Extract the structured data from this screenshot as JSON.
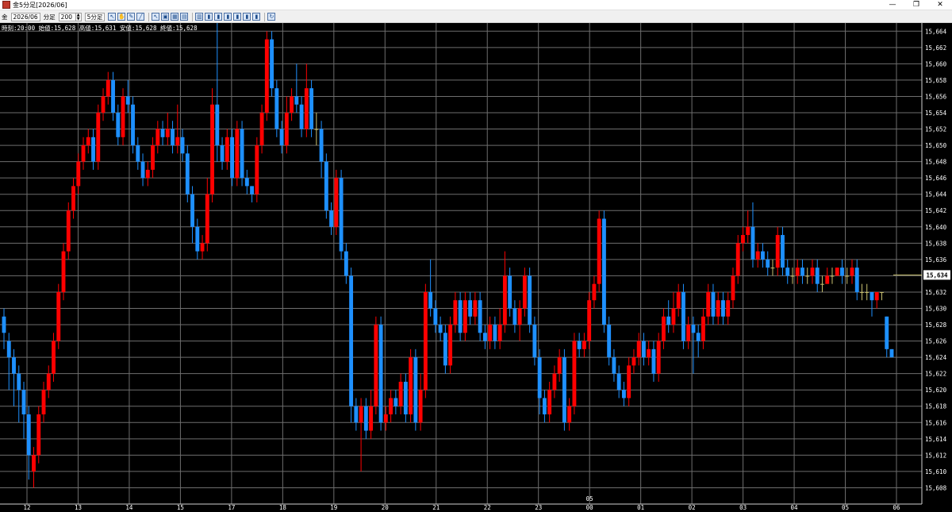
{
  "window": {
    "title": "金5分足[2026/06]",
    "controls": [
      "—",
      "❐",
      "✕"
    ]
  },
  "toolbar": {
    "symbol": "金",
    "contract": "2026/06",
    "interval_unit": "分足",
    "bar_count": "200",
    "interval": "5分足"
  },
  "info_bar": "時刻:20:00 始値:15,628 高値:15,631 安値:15,628 終値:15,628",
  "colors": {
    "up": "#ff0000",
    "down": "#1e90ff",
    "doji": "#c8c070",
    "grid": "#6e6e6e",
    "text": "#ffffff"
  },
  "chart_data": {
    "type": "candlestick",
    "y_range": [
      15606,
      15665
    ],
    "y_ticks": [
      15608,
      15610,
      15612,
      15614,
      15616,
      15618,
      15620,
      15622,
      15624,
      15626,
      15628,
      15630,
      15632,
      15634,
      15636,
      15638,
      15640,
      15642,
      15644,
      15646,
      15648,
      15650,
      15652,
      15654,
      15656,
      15658,
      15660,
      15662,
      15664
    ],
    "y_tick_labels": [
      "15,608",
      "15,610",
      "15,612",
      "15,614",
      "15,616",
      "15,618",
      "15,620",
      "15,622",
      "15,624",
      "15,626",
      "15,628",
      "15,630",
      "15,632",
      "15,634",
      "15,636",
      "15,638",
      "15,640",
      "15,642",
      "15,644",
      "15,646",
      "15,648",
      "15,650",
      "15,652",
      "15,654",
      "15,656",
      "15,658",
      "15,660",
      "15,662",
      "15,664"
    ],
    "current_price": "15,634",
    "current_value": 15634.1,
    "x_labels": [
      "12",
      "13",
      "14",
      "15",
      "17",
      "18",
      "19",
      "20",
      "21",
      "22",
      "23",
      "00",
      "01",
      "02",
      "03",
      "04",
      "05",
      "06"
    ],
    "month_label": "05",
    "candles": [
      [
        15629,
        15627,
        15630,
        15625
      ],
      [
        15626,
        15624,
        15627,
        15620
      ],
      [
        15624,
        15622,
        15625,
        15618
      ],
      [
        15622,
        15620,
        15623,
        15616
      ],
      [
        15620,
        15617,
        15621,
        15614
      ],
      [
        15617,
        15612,
        15618,
        15609
      ],
      [
        15610,
        15612,
        15613,
        15608
      ],
      [
        15612,
        15617,
        15618,
        15611
      ],
      [
        15617,
        15620,
        15621,
        15616
      ],
      [
        15620,
        15622,
        15623,
        15619
      ],
      [
        15622,
        15626,
        15627,
        15621
      ],
      [
        15626,
        15632,
        15633,
        15625
      ],
      [
        15632,
        15637,
        15638,
        15631
      ],
      [
        15637,
        15642,
        15643,
        15636
      ],
      [
        15642,
        15645,
        15646,
        15641
      ],
      [
        15645,
        15648,
        15649,
        15644
      ],
      [
        15648,
        15650,
        15651,
        15647
      ],
      [
        15650,
        15651,
        15652,
        15649
      ],
      [
        15651,
        15648,
        15652,
        15647
      ],
      [
        15648,
        15654,
        15655,
        15647
      ],
      [
        15654,
        15656,
        15657,
        15653
      ],
      [
        15656,
        15658,
        15659,
        15655
      ],
      [
        15658,
        15654,
        15659,
        15653
      ],
      [
        15654,
        15651,
        15655,
        15650
      ],
      [
        15651,
        15656,
        15657,
        15650
      ],
      [
        15656,
        15655,
        15658,
        15654
      ],
      [
        15655,
        15650,
        15656,
        15649
      ],
      [
        15650,
        15648,
        15651,
        15647
      ],
      [
        15648,
        15646,
        15649,
        15645
      ],
      [
        15646,
        15647,
        15648,
        15645
      ],
      [
        15647,
        15650,
        15651,
        15646
      ],
      [
        15650,
        15652,
        15653,
        15649
      ],
      [
        15652,
        15651,
        15653,
        15650
      ],
      [
        15651,
        15652,
        15654,
        15650
      ],
      [
        15652,
        15650,
        15653,
        15649
      ],
      [
        15650,
        15651,
        15655,
        15649
      ],
      [
        15651,
        15649,
        15652,
        15648
      ],
      [
        15649,
        15644,
        15650,
        15643
      ],
      [
        15644,
        15640,
        15645,
        15638
      ],
      [
        15640,
        15637,
        15641,
        15636
      ],
      [
        15637,
        15638,
        15639,
        15636
      ],
      [
        15638,
        15644,
        15646,
        15637
      ],
      [
        15644,
        15655,
        15657,
        15643
      ],
      [
        15655,
        15650,
        15665,
        15648
      ],
      [
        15650,
        15648,
        15651,
        15647
      ],
      [
        15648,
        15651,
        15652,
        15647
      ],
      [
        15651,
        15646,
        15652,
        15645
      ],
      [
        15646,
        15652,
        15653,
        15645
      ],
      [
        15652,
        15646,
        15653,
        15645
      ],
      [
        15646,
        15645,
        15647,
        15644
      ],
      [
        15645,
        15644,
        15645,
        15643
      ],
      [
        15644,
        15650,
        15651,
        15643
      ],
      [
        15650,
        15654,
        15655,
        15649
      ],
      [
        15654,
        15663,
        15664,
        15653
      ],
      [
        15663,
        15657,
        15664,
        15656
      ],
      [
        15657,
        15652,
        15658,
        15651
      ],
      [
        15652,
        15650,
        15653,
        15649
      ],
      [
        15650,
        15654,
        15656,
        15649
      ],
      [
        15654,
        15656,
        15657,
        15653
      ],
      [
        15656,
        15655,
        15660,
        15654
      ],
      [
        15655,
        15652,
        15656,
        15651
      ],
      [
        15652,
        15657,
        15660,
        15651
      ],
      [
        15657,
        15652,
        15658,
        15651
      ],
      [
        15652,
        15652,
        15654,
        15650
      ],
      [
        15652,
        15648,
        15653,
        15646
      ],
      [
        15648,
        15642,
        15649,
        15641
      ],
      [
        15642,
        15640,
        15643,
        15639
      ],
      [
        15640,
        15646,
        15647,
        15639
      ],
      [
        15646,
        15637,
        15647,
        15636
      ],
      [
        15637,
        15634,
        15638,
        15633
      ],
      [
        15634,
        15618,
        15635,
        15616
      ],
      [
        15618,
        15616,
        15619,
        15615
      ],
      [
        15616,
        15618,
        15619,
        15610
      ],
      [
        15618,
        15615,
        15619,
        15614
      ],
      [
        15615,
        15618,
        15620,
        15614
      ],
      [
        15618,
        15628,
        15629,
        15617
      ],
      [
        15628,
        15616,
        15629,
        15615
      ],
      [
        15616,
        15617,
        15618,
        15615
      ],
      [
        15617,
        15619,
        15620,
        15616
      ],
      [
        15619,
        15618,
        15620,
        15617
      ],
      [
        15618,
        15621,
        15622,
        15617
      ],
      [
        15621,
        15617,
        15622,
        15616
      ],
      [
        15617,
        15624,
        15625,
        15616
      ],
      [
        15624,
        15616,
        15625,
        15615
      ],
      [
        15616,
        15620,
        15622,
        15615
      ],
      [
        15620,
        15632,
        15633,
        15619
      ],
      [
        15632,
        15630,
        15636,
        15629
      ],
      [
        15630,
        15628,
        15631,
        15627
      ],
      [
        15628,
        15627,
        15629,
        15626
      ],
      [
        15627,
        15623,
        15628,
        15622
      ],
      [
        15623,
        15628,
        15629,
        15622
      ],
      [
        15628,
        15631,
        15632,
        15627
      ],
      [
        15631,
        15627,
        15632,
        15626
      ],
      [
        15627,
        15631,
        15632,
        15626
      ],
      [
        15631,
        15629,
        15632,
        15628
      ],
      [
        15629,
        15631,
        15632,
        15628
      ],
      [
        15631,
        15627,
        15632,
        15626
      ],
      [
        15627,
        15626,
        15628,
        15625
      ],
      [
        15626,
        15628,
        15629,
        15625
      ],
      [
        15628,
        15626,
        15629,
        15625
      ],
      [
        15626,
        15628,
        15630,
        15625
      ],
      [
        15628,
        15634,
        15637,
        15627
      ],
      [
        15634,
        15630,
        15635,
        15629
      ],
      [
        15630,
        15628,
        15631,
        15627
      ],
      [
        15628,
        15630,
        15631,
        15626
      ],
      [
        15630,
        15634,
        15635,
        15629
      ],
      [
        15634,
        15628,
        15635,
        15627
      ],
      [
        15628,
        15624,
        15629,
        15623
      ],
      [
        15624,
        15619,
        15625,
        15617
      ],
      [
        15619,
        15617,
        15620,
        15616
      ],
      [
        15617,
        15620,
        15621,
        15616
      ],
      [
        15620,
        15622,
        15623,
        15619
      ],
      [
        15622,
        15624,
        15625,
        15621
      ],
      [
        15624,
        15616,
        15625,
        15615
      ],
      [
        15616,
        15618,
        15619,
        15615
      ],
      [
        15618,
        15626,
        15627,
        15617
      ],
      [
        15626,
        15625,
        15627,
        15624
      ],
      [
        15625,
        15626,
        15627,
        15624
      ],
      [
        15626,
        15631,
        15632,
        15625
      ],
      [
        15631,
        15633,
        15634,
        15630
      ],
      [
        15633,
        15641,
        15642,
        15632
      ],
      [
        15641,
        15628,
        15642,
        15627
      ],
      [
        15628,
        15624,
        15629,
        15623
      ],
      [
        15624,
        15622,
        15625,
        15621
      ],
      [
        15622,
        15620,
        15623,
        15619
      ],
      [
        15620,
        15619,
        15621,
        15618
      ],
      [
        15619,
        15623,
        15624,
        15618
      ],
      [
        15623,
        15624,
        15625,
        15622
      ],
      [
        15624,
        15626,
        15627,
        15623
      ],
      [
        15626,
        15624,
        15627,
        15623
      ],
      [
        15624,
        15625,
        15626,
        15623
      ],
      [
        15625,
        15622,
        15626,
        15621
      ],
      [
        15622,
        15626,
        15627,
        15621
      ],
      [
        15626,
        15629,
        15630,
        15625
      ],
      [
        15629,
        15628,
        15631,
        15627
      ],
      [
        15628,
        15630,
        15632,
        15627
      ],
      [
        15630,
        15632,
        15633,
        15629
      ],
      [
        15632,
        15626,
        15633,
        15625
      ],
      [
        15626,
        15628,
        15629,
        15625
      ],
      [
        15628,
        15627,
        15629,
        15622
      ],
      [
        15627,
        15626,
        15628,
        15624
      ],
      [
        15626,
        15629,
        15630,
        15625
      ],
      [
        15629,
        15632,
        15633,
        15628
      ],
      [
        15632,
        15629,
        15633,
        15628
      ],
      [
        15629,
        15631,
        15632,
        15628
      ],
      [
        15631,
        15629,
        15632,
        15628
      ],
      [
        15629,
        15631,
        15632,
        15628
      ],
      [
        15631,
        15634,
        15635,
        15630
      ],
      [
        15634,
        15638,
        15639,
        15633
      ],
      [
        15638,
        15639,
        15640,
        15637
      ],
      [
        15639,
        15640,
        15642,
        15638
      ],
      [
        15640,
        15636,
        15643,
        15635
      ],
      [
        15636,
        15637,
        15638,
        15635
      ],
      [
        15637,
        15636,
        15638,
        15635
      ],
      [
        15636,
        15635,
        15637,
        15634
      ],
      [
        15635,
        15635,
        15636,
        15634
      ],
      [
        15635,
        15639,
        15640,
        15634
      ],
      [
        15639,
        15635,
        15640,
        15634
      ],
      [
        15635,
        15634,
        15636,
        15633
      ],
      [
        15634,
        15634,
        15635,
        15633
      ],
      [
        15634,
        15635,
        15636,
        15633
      ],
      [
        15635,
        15634,
        15636,
        15633
      ],
      [
        15634,
        15634,
        15635,
        15633
      ],
      [
        15634,
        15635,
        15636,
        15633
      ],
      [
        15635,
        15633,
        15636,
        15632
      ],
      [
        15633,
        15633,
        15634,
        15632
      ],
      [
        15633,
        15634,
        15635,
        15633
      ],
      [
        15634,
        15634,
        15635,
        15633
      ],
      [
        15634,
        15635,
        15635,
        15634
      ],
      [
        15635,
        15634,
        15636,
        15633
      ],
      [
        15634,
        15634,
        15635,
        15633
      ],
      [
        15634,
        15635,
        15636,
        15633
      ],
      [
        15635,
        15632,
        15636,
        15631
      ],
      [
        15632,
        15632,
        15633,
        15631
      ],
      [
        15632,
        15632,
        15633,
        15631
      ],
      [
        15632,
        15631,
        15632,
        15629
      ],
      [
        15631,
        15632,
        15632,
        15630
      ],
      [
        15632,
        15632,
        15632,
        15631
      ],
      [
        15629,
        15625,
        15629,
        15624
      ],
      [
        15625,
        15624,
        15625,
        15624
      ]
    ]
  }
}
